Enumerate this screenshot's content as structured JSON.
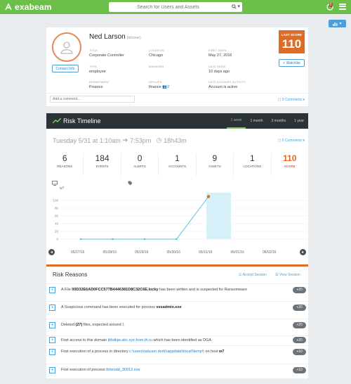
{
  "topbar": {
    "brand": "exabeam",
    "search_placeholder": "Search for Users and Assets",
    "notification_count": "6"
  },
  "profile": {
    "name": "Ned Larson",
    "user_type": "(tshooer)",
    "contact_label": "Contact Info",
    "fields": {
      "title": {
        "label": "TITLE",
        "value": "Corporate Controller"
      },
      "location": {
        "label": "LOCATION",
        "value": "Chicago"
      },
      "first_seen": {
        "label": "FIRST SEEN",
        "value": "May 27, 2016"
      },
      "type": {
        "label": "TYPE",
        "value": "employee"
      },
      "manager": {
        "label": "MANAGER",
        "value": ""
      },
      "last_seen": {
        "label": "LAST SEEN",
        "value": "10 days ago"
      },
      "department": {
        "label": "DEPARTMENT",
        "value": "Finance"
      },
      "groups": {
        "label": "GROUPS",
        "value": "finance",
        "count": "2"
      },
      "last_activity": {
        "label": "LAST ACCOUNT ACTIVITY",
        "value": "Account is active"
      }
    },
    "last_score_label": "LAST SCORE",
    "last_score": "110",
    "watchlist_label": "+ Watchlist",
    "comment_placeholder": "Add a comment...",
    "comments_count": "0 Comments"
  },
  "risk_timeline": {
    "title": "Risk Timeline",
    "tabs": [
      {
        "label": "1 week",
        "active": true
      },
      {
        "label": "1 month",
        "active": false
      },
      {
        "label": "3 months",
        "active": false
      },
      {
        "label": "1 year",
        "active": false
      }
    ],
    "session_start": "Tuesday 5/31 at 1:10am",
    "session_end": "7:53pm",
    "session_duration": "18h43m",
    "comments_count": "0 Comments",
    "stats": [
      {
        "value": "6",
        "label": "REASONS"
      },
      {
        "value": "184",
        "label": "EVENTS"
      },
      {
        "value": "0",
        "label": "ALERTS"
      },
      {
        "value": "1",
        "label": "ACCOUNTS"
      },
      {
        "value": "9",
        "label": "ASSETS"
      },
      {
        "value": "1",
        "label": "LOCATIONS"
      },
      {
        "value": "110",
        "label": "SCORE"
      }
    ],
    "host": "w7",
    "date_labels": [
      "05/27/16",
      "05/28/16",
      "05/29/16",
      "05/30/16",
      "05/31/16",
      "06/01/16",
      "06/02/16"
    ]
  },
  "chart_data": {
    "type": "line",
    "x": [
      "05/27/16",
      "05/28/16",
      "05/29/16",
      "05/30/16",
      "05/31/16"
    ],
    "values": [
      0,
      0,
      0,
      0,
      110
    ],
    "yticks": [
      0,
      20,
      40,
      60,
      80,
      100
    ],
    "ylim": [
      0,
      120
    ],
    "highlight": "05/31/16",
    "colors": {
      "line": "#5bc0de",
      "last_point": "#e06b25",
      "highlight": "#d6f0fa"
    }
  },
  "risk_reasons": {
    "title": "Risk Reasons",
    "accept_label": "Accept Session",
    "view_label": "View Session",
    "items": [
      {
        "pre": "A File ",
        "bold": "00D32E6AD0FCC577B4446381D8C32C6E.locky",
        "post": " has been written and is suspected for Ransomware",
        "points": "+20"
      },
      {
        "pre": "A Suspicious command has been executed for process ",
        "bold": "vssadmin.exe",
        "post": "",
        "points": "+20"
      },
      {
        "pre": "Deleted ",
        "bold": "(27)",
        "mid": " files, expected around ",
        "link": "1",
        "points": "+20"
      },
      {
        "pre": "First access to this domain ",
        "link": "jbhdkjw.abc.xyz.from.th.ru",
        "post": " which has been identified as DGA",
        "points": "+20"
      },
      {
        "pre": "First execution of a process in directory ",
        "link": "c:\\users\\\\abuser.dork\\\\appdata\\\\local\\\\temp\\\\",
        "mid": " on host ",
        "bold": "w7",
        "points": "+10"
      },
      {
        "pre": "First execution of process ",
        "link": "ibheodd_30912.exe",
        "points": "+10"
      }
    ]
  }
}
